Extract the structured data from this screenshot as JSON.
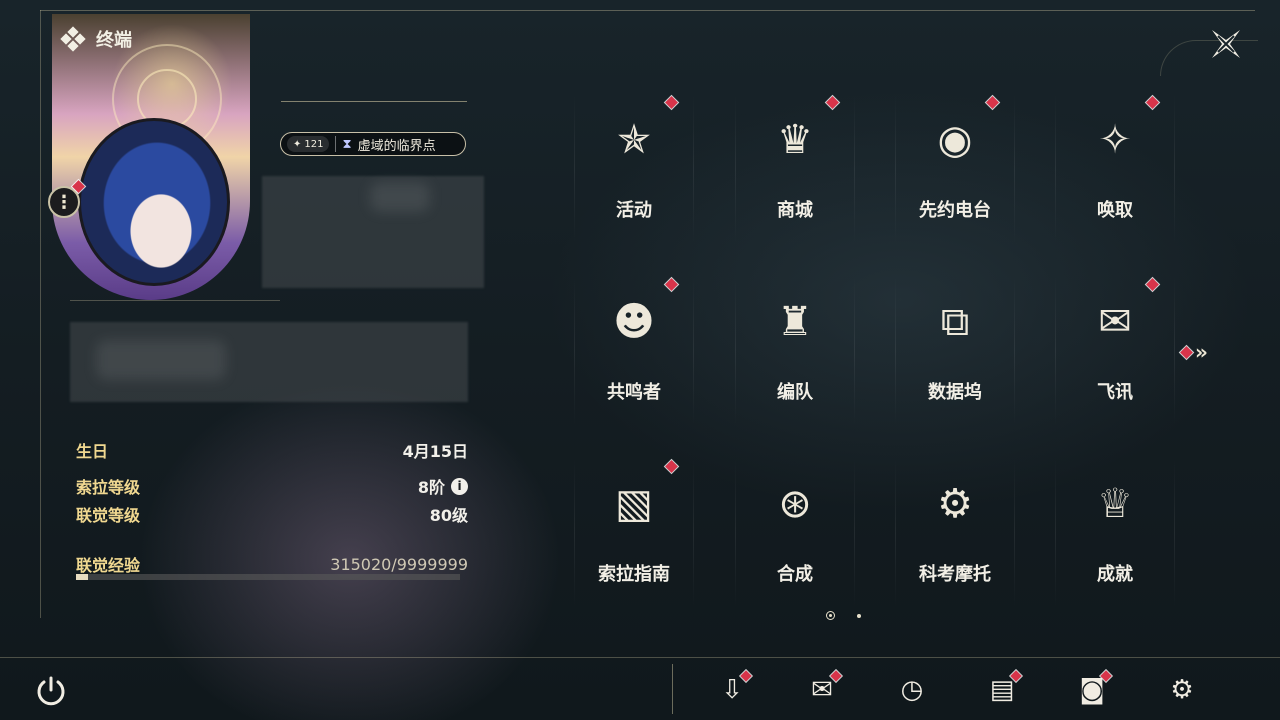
{
  "header": {
    "title": "终端"
  },
  "profile": {
    "title_badge": {
      "count": "121",
      "name": "虚域的临界点"
    }
  },
  "stats": [
    {
      "label": "生日",
      "value": "4月15日",
      "info": false
    },
    {
      "label": "索拉等级",
      "value": "8阶",
      "info": true
    },
    {
      "label": "联觉等级",
      "value": "80级",
      "info": false
    }
  ],
  "experience": {
    "label": "联觉经验",
    "value": "315020/9999999",
    "progress": 0.0315
  },
  "menu": [
    {
      "label": "活动",
      "icon": "event-icon",
      "badge": true
    },
    {
      "label": "商城",
      "icon": "shop-crown-cart-icon",
      "badge": true
    },
    {
      "label": "先约电台",
      "icon": "radio-record-icon",
      "badge": true
    },
    {
      "label": "唤取",
      "icon": "gacha-compass-icon",
      "badge": true
    },
    {
      "label": "共鸣者",
      "icon": "resonator-head-icon",
      "badge": true
    },
    {
      "label": "编队",
      "icon": "chess-team-icon",
      "badge": false
    },
    {
      "label": "数据坞",
      "icon": "data-dock-icon",
      "badge": false
    },
    {
      "label": "飞讯",
      "icon": "message-chip-icon",
      "badge": true
    },
    {
      "label": "索拉指南",
      "icon": "guidebook-icon",
      "badge": true
    },
    {
      "label": "合成",
      "icon": "synthesis-icon",
      "badge": false
    },
    {
      "label": "科考摩托",
      "icon": "motorcycle-icon",
      "badge": false
    },
    {
      "label": "成就",
      "icon": "trophy-icon",
      "badge": false
    }
  ],
  "pagination": {
    "pages": 2,
    "current": 1
  },
  "bottom_bar": [
    {
      "icon": "download-icon",
      "badge": true
    },
    {
      "icon": "mail-icon",
      "badge": true
    },
    {
      "icon": "clock-icon",
      "badge": false
    },
    {
      "icon": "notice-icon",
      "badge": true
    },
    {
      "icon": "camera-icon",
      "badge": true
    },
    {
      "icon": "settings-gear-icon",
      "badge": false
    }
  ],
  "colors": {
    "badge": "#d8344a",
    "label_gold": "#f0d890",
    "text": "#f2efe6"
  }
}
